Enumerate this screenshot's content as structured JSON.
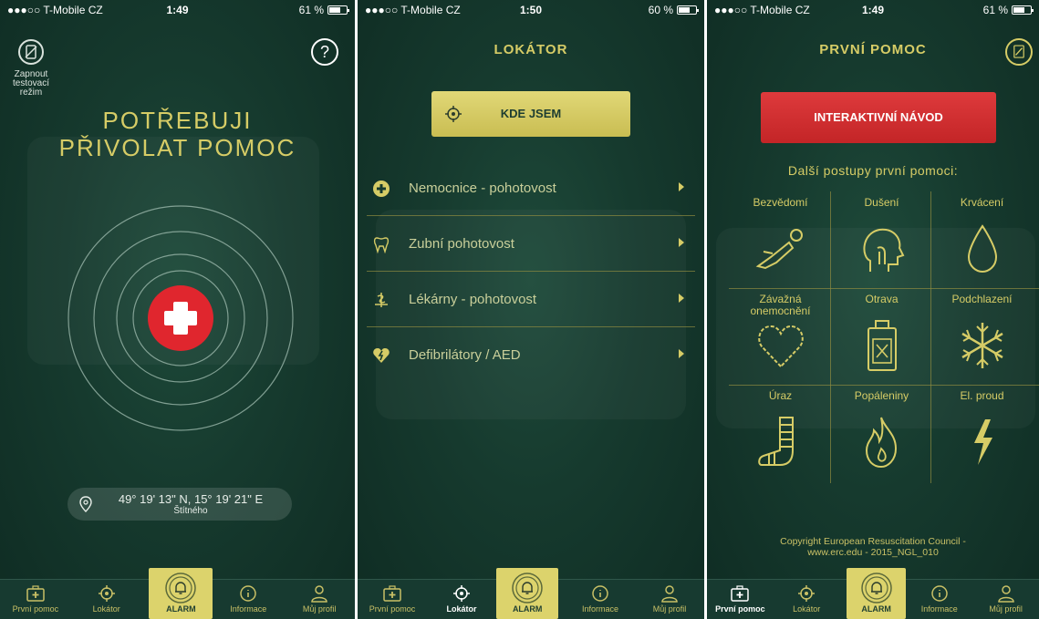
{
  "statusbars": [
    {
      "carrier": "●●●○○ T-Mobile CZ",
      "time": "1:49",
      "battery": "61 %",
      "battery_level": 0.61
    },
    {
      "carrier": "●●●○○ T-Mobile CZ",
      "time": "1:50",
      "battery": "60 %",
      "battery_level": 0.6
    },
    {
      "carrier": "●●●○○ T-Mobile CZ",
      "time": "1:49",
      "battery": "61 %",
      "battery_level": 0.61
    }
  ],
  "screen1": {
    "test_mode_label": [
      "Zapnout",
      "testovací",
      "režim"
    ],
    "help_label": "?",
    "title_line1": "POTŘEBUJI",
    "title_line2": "PŘIVOLAT POMOC",
    "coords": "49° 19' 13\" N, 15° 19' 21\" E",
    "street": "Štítného"
  },
  "screen2": {
    "title": "LOKÁTOR",
    "where_button": "KDE JSEM",
    "items": [
      {
        "label": "Nemocnice - pohotovost",
        "icon": "medical-cross-icon"
      },
      {
        "label": "Zubní pohotovost",
        "icon": "tooth-icon"
      },
      {
        "label": "Lékárny - pohotovost",
        "icon": "pharmacy-icon"
      },
      {
        "label": "Defibrilátory / AED",
        "icon": "defibrillator-heart-icon"
      }
    ]
  },
  "screen3": {
    "title": "PRVNÍ POMOC",
    "interactive_button": "INTERAKTIVNÍ NÁVOD",
    "subheading": "Další postupy první pomoci:",
    "cells": [
      {
        "label": "Bezvědomí",
        "icon": "unconscious-person-icon"
      },
      {
        "label": "Dušení",
        "icon": "choking-head-icon"
      },
      {
        "label": "Krvácení",
        "icon": "blood-drop-icon"
      },
      {
        "label": "Závažná onemocnění",
        "icon": "heart-icon"
      },
      {
        "label": "Otrava",
        "icon": "poison-bottle-icon"
      },
      {
        "label": "Podchlazení",
        "icon": "snowflake-icon"
      },
      {
        "label": "Úraz",
        "icon": "bandaged-foot-icon"
      },
      {
        "label": "Popáleniny",
        "icon": "flame-icon"
      },
      {
        "label": "El. proud",
        "icon": "lightning-icon"
      }
    ],
    "copyright_line1": "Copyright European Resuscitation Council -",
    "copyright_line2": "www.erc.edu - 2015_NGL_010"
  },
  "tabs": {
    "first_aid": "První pomoc",
    "locator": "Lokátor",
    "alarm": "ALARM",
    "info": "Informace",
    "profile": "Můj profil"
  },
  "colors": {
    "background": "#163a2e",
    "accent_gold": "#d6cc66",
    "alarm_red": "#e0262e",
    "button_red": "#d02f31"
  }
}
